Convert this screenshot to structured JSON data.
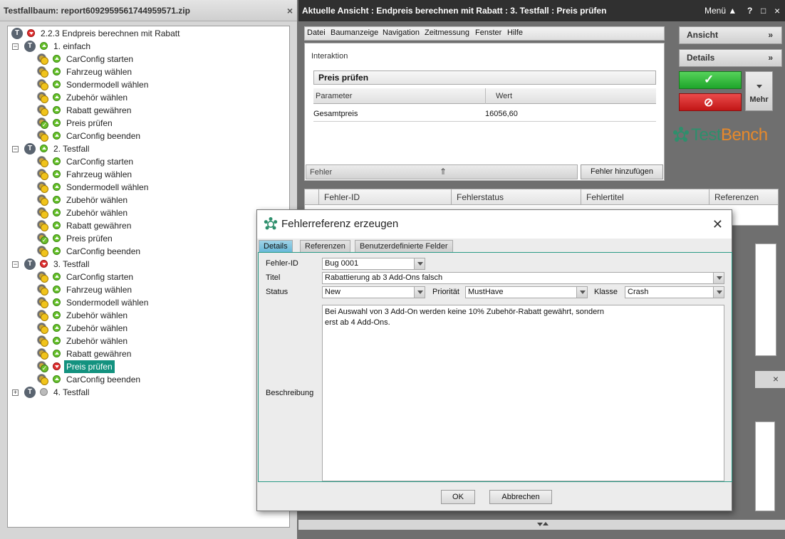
{
  "tree_panel": {
    "title": "Testfallbaum: report6092959561744959571.zip",
    "close": "×",
    "items": [
      {
        "label": "2.2.3 Endpreis berechnen mit Rabatt",
        "kind": "T",
        "status": "red",
        "level": 0
      },
      {
        "label": "1. einfach",
        "kind": "T",
        "status": "green",
        "level": 1,
        "expander": "−"
      },
      {
        "label": "CarConfig starten",
        "kind": "kw",
        "status": "green",
        "level": 2
      },
      {
        "label": "Fahrzeug wählen",
        "kind": "kw",
        "status": "green",
        "level": 2
      },
      {
        "label": "Sondermodell wählen",
        "kind": "kw",
        "status": "green",
        "level": 2
      },
      {
        "label": "Zubehör wählen",
        "kind": "kw",
        "status": "green",
        "level": 2
      },
      {
        "label": "Rabatt gewähren",
        "kind": "kw",
        "status": "green",
        "level": 2
      },
      {
        "label": "Preis prüfen",
        "kind": "kwok",
        "status": "green",
        "level": 2
      },
      {
        "label": "CarConfig beenden",
        "kind": "kw",
        "status": "green",
        "level": 2
      },
      {
        "label": "2. Testfall",
        "kind": "T",
        "status": "green",
        "level": 1,
        "expander": "−"
      },
      {
        "label": "CarConfig starten",
        "kind": "kw",
        "status": "green",
        "level": 2
      },
      {
        "label": "Fahrzeug wählen",
        "kind": "kw",
        "status": "green",
        "level": 2
      },
      {
        "label": "Sondermodell wählen",
        "kind": "kw",
        "status": "green",
        "level": 2
      },
      {
        "label": "Zubehör wählen",
        "kind": "kw",
        "status": "green",
        "level": 2
      },
      {
        "label": "Zubehör wählen",
        "kind": "kw",
        "status": "green",
        "level": 2
      },
      {
        "label": "Rabatt gewähren",
        "kind": "kw",
        "status": "green",
        "level": 2
      },
      {
        "label": "Preis prüfen",
        "kind": "kwok",
        "status": "green",
        "level": 2
      },
      {
        "label": "CarConfig beenden",
        "kind": "kw",
        "status": "green",
        "level": 2
      },
      {
        "label": "3. Testfall",
        "kind": "T",
        "status": "red",
        "level": 1,
        "expander": "−"
      },
      {
        "label": "CarConfig starten",
        "kind": "kw",
        "status": "green",
        "level": 2
      },
      {
        "label": "Fahrzeug wählen",
        "kind": "kw",
        "status": "green",
        "level": 2
      },
      {
        "label": "Sondermodell wählen",
        "kind": "kw",
        "status": "green",
        "level": 2
      },
      {
        "label": "Zubehör wählen",
        "kind": "kw",
        "status": "green",
        "level": 2
      },
      {
        "label": "Zubehör wählen",
        "kind": "kw",
        "status": "green",
        "level": 2
      },
      {
        "label": "Zubehör wählen",
        "kind": "kw",
        "status": "green",
        "level": 2
      },
      {
        "label": "Rabatt gewähren",
        "kind": "kw",
        "status": "green",
        "level": 2
      },
      {
        "label": "Preis prüfen",
        "kind": "kwok",
        "status": "red",
        "level": 2,
        "selected": true
      },
      {
        "label": "CarConfig beenden",
        "kind": "kw",
        "status": "green",
        "level": 2
      },
      {
        "label": "4. Testfall",
        "kind": "T",
        "status": "gray",
        "level": 1,
        "expander": "+"
      }
    ]
  },
  "main": {
    "title": "Aktuelle Ansicht : Endpreis berechnen mit Rabatt : 3. Testfall : Preis prüfen",
    "menu_label": "Menü ▲",
    "help": "?",
    "maximize": "□",
    "close": "×",
    "menubar": [
      "Datei",
      "Baumanzeige",
      "Navigation",
      "Zeitmessung",
      "Fenster",
      "Hilfe"
    ],
    "interaction": {
      "label": "Interaktion",
      "name": "Preis prüfen",
      "columns": [
        "Parameter",
        "Wert"
      ],
      "rows": [
        {
          "param": "Gesamtpreis",
          "value": "16056,60"
        }
      ],
      "fehler_label": "Fehler",
      "expand_glyph": "⇑",
      "add_error_button": "Fehler hinzufügen"
    },
    "side": {
      "ansicht": "Ansicht",
      "details": "Details",
      "chevron": "»",
      "mehr": "Mehr",
      "pass_glyph": "✓",
      "fail_glyph": "⊘",
      "logo": "TestBench"
    },
    "error_table": {
      "columns": [
        "Fehler-ID",
        "Fehlerstatus",
        "Fehlertitel",
        "Referenzen"
      ]
    },
    "side_close": "×"
  },
  "dialog": {
    "title": "Fehlerreferenz erzeugen",
    "close": "✕",
    "tabs": [
      "Details",
      "Referenzen",
      "Benutzerdefinierte Felder"
    ],
    "fields": {
      "fehler_id_label": "Fehler-ID",
      "fehler_id": "Bug 0001",
      "titel_label": "Titel",
      "titel": "Rabattierung ab 3 Add-Ons falsch",
      "status_label": "Status",
      "status": "New",
      "prioritaet_label": "Priorität",
      "prioritaet": "MustHave",
      "klasse_label": "Klasse",
      "klasse": "Crash",
      "beschreibung_label": "Beschreibung",
      "beschreibung": "Bei Auswahl von 3 Add-On werden keine 10% Zubehör-Rabatt gewährt, sondern\nerst ab 4 Add-Ons."
    },
    "ok": "OK",
    "cancel": "Abbrechen"
  },
  "colors": {
    "selection": "#13927f",
    "title_dark": "#303030",
    "pass": "#1ea62b",
    "fail": "#c21616",
    "logo_green": "#2e8f6c",
    "logo_orange": "#e6892b"
  }
}
